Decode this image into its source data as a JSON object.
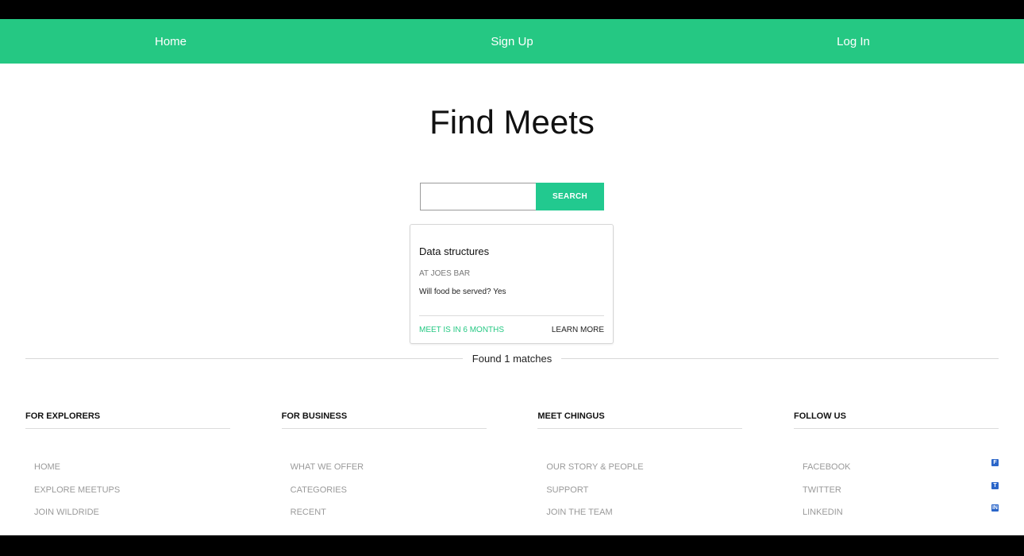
{
  "nav": {
    "home": "Home",
    "signup": "Sign Up",
    "login": "Log In"
  },
  "page": {
    "title": "Find Meets"
  },
  "search": {
    "value": "",
    "placeholder": "",
    "button_label": "SEARCH"
  },
  "card": {
    "title": "Data structures",
    "venue": "AT JOES BAR",
    "food": "Will food be served? Yes",
    "when": "MEET IS IN 6 MONTHS",
    "learn_more": "LEARN MORE"
  },
  "results": {
    "text": "Found 1 matches"
  },
  "footer": {
    "explorers": {
      "heading": "FOR EXPLORERS",
      "items": [
        "HOME",
        "EXPLORE MEETUPS",
        "JOIN WILDRIDE"
      ]
    },
    "business": {
      "heading": "FOR BUSINESS",
      "items": [
        "WHAT WE OFFER",
        "CATEGORIES",
        "RECENT"
      ]
    },
    "chingus": {
      "heading": "MEET CHINGUS",
      "items": [
        "OUR STORY & PEOPLE",
        "SUPPORT",
        "JOIN THE TEAM"
      ]
    },
    "follow": {
      "heading": "FOLLOW US",
      "items": [
        "FACEBOOK",
        "TWITTER",
        "LINKEDIN"
      ],
      "icons": [
        "facebook-icon",
        "twitter-icon",
        "linkedin-icon"
      ]
    }
  },
  "colors": {
    "accent": "#25c883",
    "button": "#22c98f"
  }
}
